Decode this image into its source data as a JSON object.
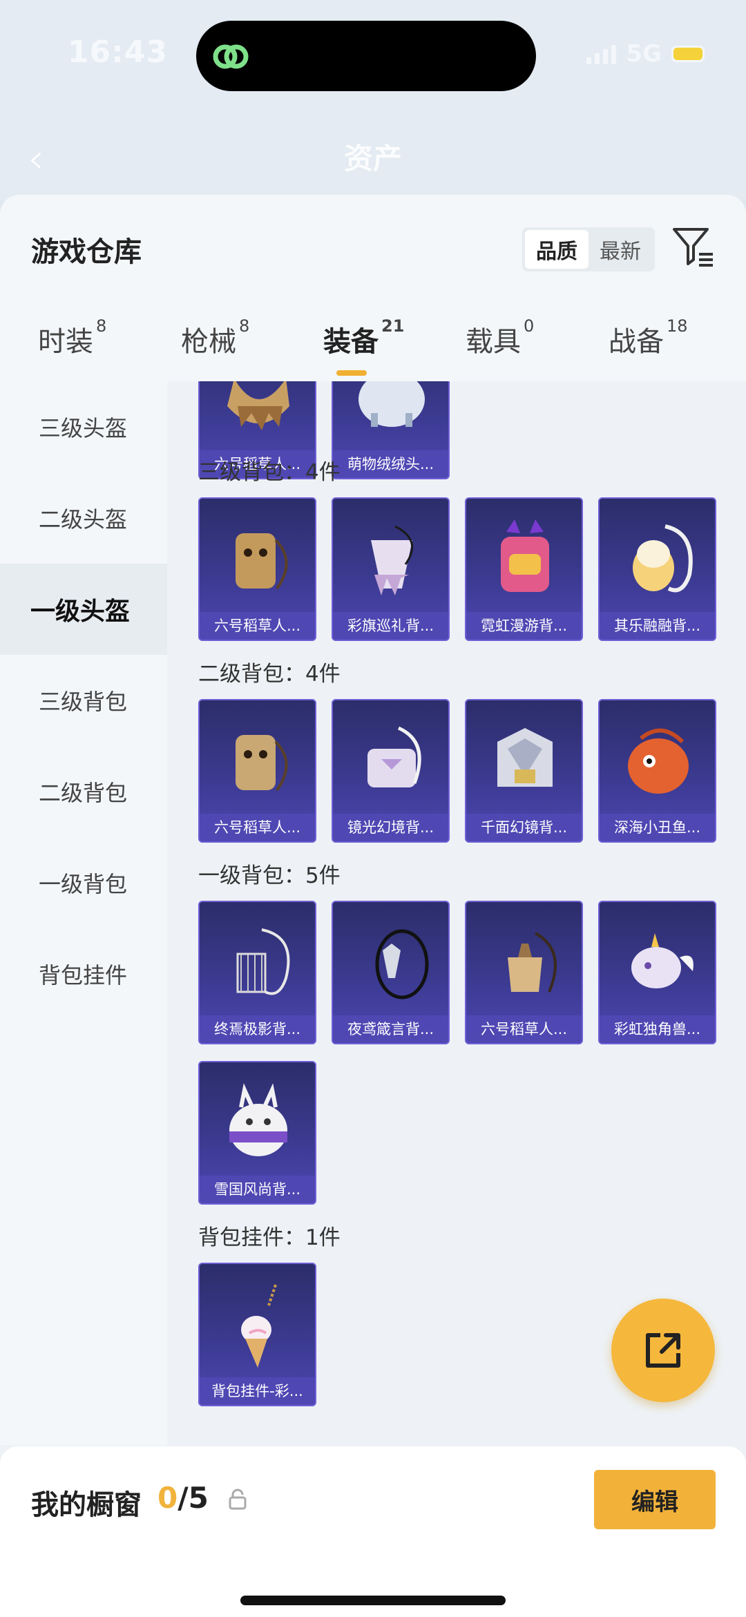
{
  "status_bar": {
    "time": "16:43",
    "network": "5G"
  },
  "background_app": {
    "title": "资产"
  },
  "sheet": {
    "title": "游戏仓库",
    "sort_options": [
      "品质",
      "最新"
    ],
    "sort_selected": "品质"
  },
  "tabs": [
    {
      "label": "时装",
      "count": "8"
    },
    {
      "label": "枪械",
      "count": "8"
    },
    {
      "label": "装备",
      "count": "21"
    },
    {
      "label": "载具",
      "count": "0"
    },
    {
      "label": "战备",
      "count": "18"
    }
  ],
  "active_tab": "装备",
  "side_nav": {
    "items": [
      "三级头盔",
      "二级头盔",
      "一级头盔",
      "三级背包",
      "二级背包",
      "一级背包",
      "背包挂件"
    ],
    "active": "一级头盔"
  },
  "sections": {
    "helmet_1_partial": {
      "items": [
        "六号稻草人...",
        "萌物绒绒头..."
      ]
    },
    "backpack_3": {
      "title": "三级背包：4件",
      "items": [
        "六号稻草人...",
        "彩旗巡礼背...",
        "霓虹漫游背...",
        "其乐融融背..."
      ]
    },
    "backpack_2": {
      "title": "二级背包：4件",
      "items": [
        "六号稻草人...",
        "镜光幻境背...",
        "千面幻镜背...",
        "深海小丑鱼..."
      ]
    },
    "backpack_1": {
      "title": "一级背包：5件",
      "items": [
        "终焉极影背...",
        "夜鸢箴言背...",
        "六号稻草人...",
        "彩虹独角兽...",
        "雪国风尚背..."
      ]
    },
    "charm": {
      "title": "背包挂件：1件",
      "items": [
        "背包挂件-彩..."
      ]
    }
  },
  "showcase": {
    "label": "我的橱窗",
    "current": "0",
    "total": "/5",
    "edit_label": "编辑"
  },
  "colors": {
    "accent": "#f2b23a",
    "card_bg": "#3b3a90",
    "card_border": "#6f5fd6"
  }
}
